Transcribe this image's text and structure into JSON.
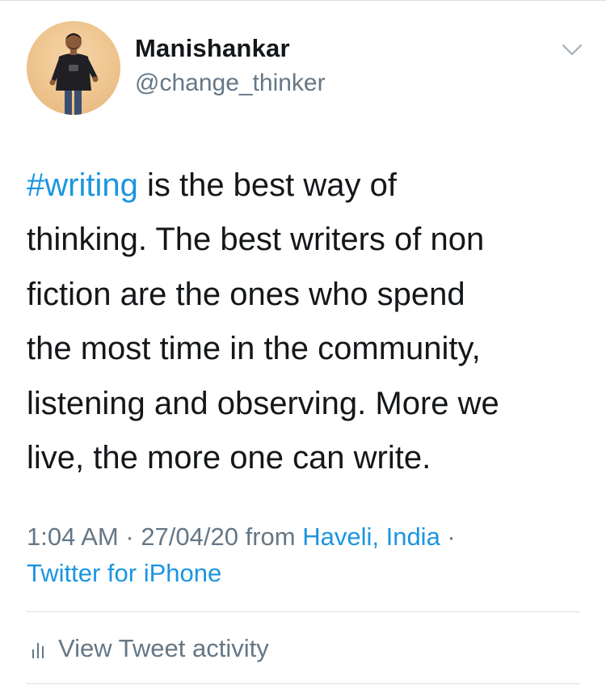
{
  "author": {
    "display_name": "Manishankar",
    "handle": "@change_thinker"
  },
  "icons": {
    "avatar": "profile-photo",
    "menu": "chevron-down-icon",
    "activity": "bar-chart-icon"
  },
  "tweet": {
    "hashtag": "#writing",
    "line1_rest": " is the best way of",
    "line2": "thinking. The best writers of non",
    "line3": "fiction are the ones who spend",
    "line4": "the most time in the community,",
    "line5": "listening and observing. More we",
    "line6": "live, the more one can write."
  },
  "meta": {
    "time": "1:04 AM",
    "separator": " · ",
    "date": "27/04/20",
    "from_label": " from ",
    "location": "Haveli, India",
    "trailing_separator": " ·",
    "source": "Twitter for iPhone"
  },
  "activity": {
    "label": "View Tweet activity"
  },
  "colors": {
    "link": "#1b95e0",
    "secondary_text": "#657786",
    "primary_text": "#14171a",
    "divider": "#d8dee3"
  }
}
